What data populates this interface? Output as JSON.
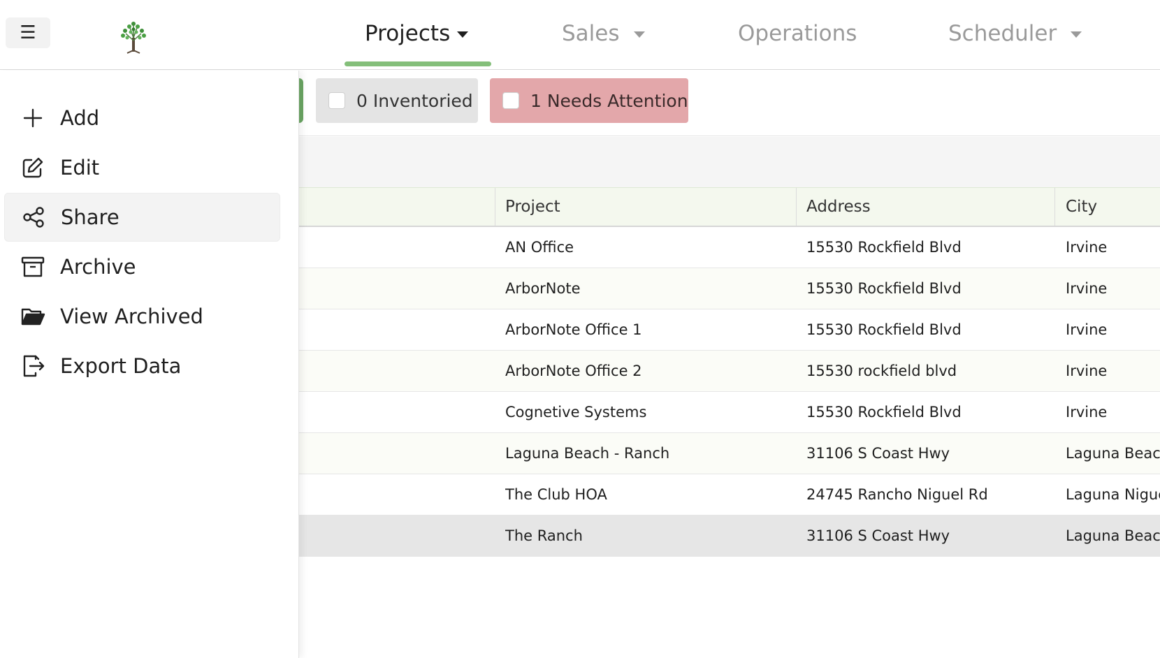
{
  "header": {
    "tabs": [
      {
        "label": "Projects",
        "active": true,
        "has_dropdown": true
      },
      {
        "label": "Sales",
        "active": false,
        "has_dropdown": true
      },
      {
        "label": "Operations",
        "active": false,
        "has_dropdown": false
      },
      {
        "label": "Scheduler",
        "active": false,
        "has_dropdown": true
      }
    ],
    "accent_color": "#84bf7a"
  },
  "filters": {
    "inventoried": {
      "label": "0 Inventoried",
      "checked": false,
      "color": "#e4e4e4"
    },
    "needs_attention": {
      "label": "1 Needs Attention",
      "checked": false,
      "color": "#e3a7aa"
    }
  },
  "sidebar": {
    "items": [
      {
        "label": "Add",
        "icon": "plus-icon"
      },
      {
        "label": "Edit",
        "icon": "edit-icon"
      },
      {
        "label": "Share",
        "icon": "share-icon"
      },
      {
        "label": "Archive",
        "icon": "archive-icon"
      },
      {
        "label": "View Archived",
        "icon": "folder-open-icon"
      },
      {
        "label": "Export Data",
        "icon": "export-icon"
      }
    ]
  },
  "table": {
    "columns": [
      "Project",
      "Address",
      "City"
    ],
    "rows": [
      {
        "project": "AN Office",
        "address": "15530 Rockfield Blvd",
        "city": "Irvine"
      },
      {
        "project": "ArborNote",
        "address": "15530 Rockfield Blvd",
        "city": "Irvine"
      },
      {
        "project": "ArborNote Office 1",
        "address": "15530 Rockfield Blvd",
        "city": "Irvine"
      },
      {
        "project": "ArborNote Office 2",
        "address": "15530 rockfield blvd",
        "city": "Irvine"
      },
      {
        "project": "Cognetive Systems",
        "address": "15530 Rockfield Blvd",
        "city": "Irvine"
      },
      {
        "project": "Laguna Beach - Ranch",
        "address": "31106 S Coast Hwy",
        "city": "Laguna Beach"
      },
      {
        "project": "The Club HOA",
        "address": "24745 Rancho Niguel Rd",
        "city": "Laguna Niguel"
      },
      {
        "project": "The Ranch",
        "address": "31106 S Coast Hwy",
        "city": "Laguna Beach"
      }
    ]
  }
}
